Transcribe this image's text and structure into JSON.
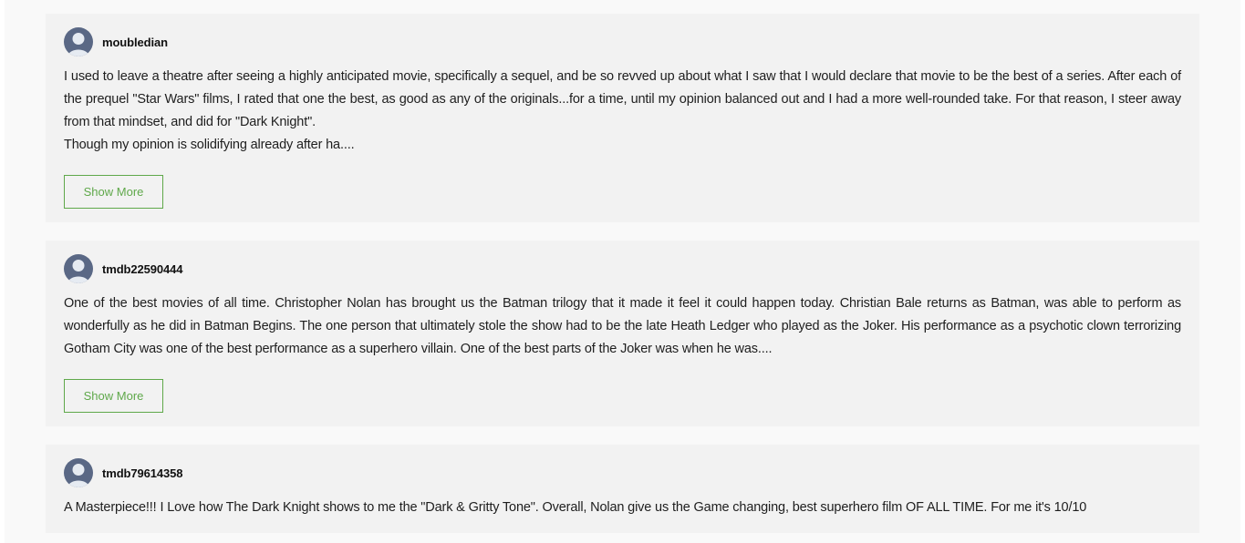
{
  "reviews": [
    {
      "username": "moubledian",
      "avatar_icon": "user-avatar-icon",
      "paragraphs": [
        "I used to leave a theatre after seeing a highly anticipated movie, specifically a sequel, and be so revved up about what I saw that I would declare that movie to be the best of a series. After each of the prequel \"Star Wars\" films, I rated that one the best, as good as any of the originals...for a time, until my opinion balanced out and I had a more well-rounded take. For that reason, I steer away from that mindset, and did for \"Dark Knight\".",
        "Though my opinion is solidifying already after ha...."
      ],
      "button_label": "Show More"
    },
    {
      "username": "tmdb22590444",
      "avatar_icon": "user-avatar-icon",
      "paragraphs": [
        "One of the best movies of all time. Christopher Nolan has brought us the Batman trilogy that it made it feel it could happen today. Christian Bale returns as Batman, was able to perform as wonderfully as he did in Batman Begins. The one person that ultimately stole the show had to be the late Heath Ledger who played as the Joker. His performance as a psychotic clown terrorizing Gotham City was one of the best performance as a superhero villain. One of the best parts of the Joker was when he was...."
      ],
      "button_label": "Show More"
    },
    {
      "username": "tmdb79614358",
      "avatar_icon": "user-avatar-icon",
      "paragraphs": [
        "A Masterpiece!!! I Love how The Dark Knight shows to me the \"Dark & Gritty Tone\". Overall, Nolan give us the Game changing, best superhero film OF ALL TIME. For me it's 10/10"
      ]
    }
  ],
  "colors": {
    "accent": "#5fa84a",
    "card_bg": "#f2f2f2",
    "avatar_bg": "#5a6885"
  }
}
